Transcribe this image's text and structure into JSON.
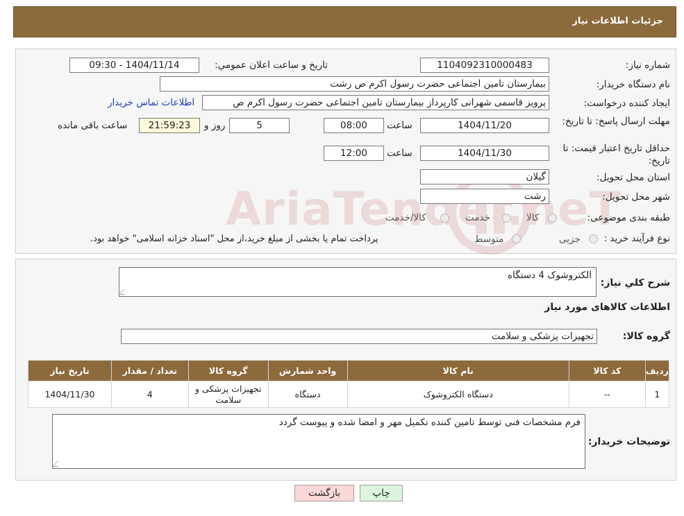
{
  "header": {
    "title": "جزئیات اطلاعات نیاز"
  },
  "form": {
    "need_number": {
      "label": "شماره نیاز:",
      "value": "1104092310000483"
    },
    "announce_datetime": {
      "label": "تاریخ و ساعت اعلان عمومي:",
      "value": "1404/11/14 - 09:30"
    },
    "buyer_org": {
      "label": "نام دستگاه خریدار:",
      "value": "بیمارستان  تامین اجتماعی حضرت رسول اکرم ص رشت"
    },
    "requester": {
      "label": "ایجاد کننده درخواست:",
      "value": "پرویز قاسمی شهرانی کارپرداز بیمارستان  تامین اجتماعی حضرت رسول اکرم ص"
    },
    "contact_link": "اطلاعات تماس خریدار",
    "send_deadline": {
      "label": "مهلت ارسال پاسخ: تا تاریخ:",
      "date": "1404/11/20",
      "time_label": "ساعت",
      "time": "08:00",
      "days": "5",
      "days_label": "روز و",
      "remaining": "21:59:23",
      "remaining_label": "ساعت باقی مانده"
    },
    "price_validity": {
      "label": "حداقل تاریخ اعتبار قیمت: تا تاریخ:",
      "date": "1404/11/30",
      "time_label": "ساعت",
      "time": "12:00"
    },
    "province": {
      "label": "استان محل تحویل:",
      "value": "گیلان"
    },
    "city": {
      "label": "شهر محل تحویل:",
      "value": "رشت"
    },
    "category": {
      "label": "طبقه بندی موضوعی:",
      "options": [
        "کالا",
        "خدمت",
        "کالا/خدمت"
      ]
    },
    "process": {
      "label": "نوع فرآیند خرید :",
      "options": [
        "جزیی",
        "متوسط"
      ],
      "note": "پرداخت تمام یا بخشی از مبلغ خرید،از محل \"اسناد خزانه اسلامی\" خواهد بود."
    }
  },
  "watermark": "AriaTender.neT",
  "details": {
    "summary_label": "شرح کلي نياز:",
    "summary_value": "الکتروشوک 4 دستگاه",
    "goods_title": "اطلاعات کالاهای مورد نیاز",
    "goods_group_label": "گروه کالا:",
    "goods_group_value": "تجهیزات پزشکی و سلامت"
  },
  "table": {
    "headers": [
      "ردیف",
      "کد کالا",
      "نام کالا",
      "واحد شمارش",
      "گروه کالا",
      "تعداد / مقدار",
      "تاریخ نیاز"
    ],
    "rows": [
      [
        "1",
        "--",
        "دستگاه الکتروشوک",
        "دستگاه",
        "تجهیزات پزشکی و سلامت",
        "4",
        "1404/11/30"
      ]
    ]
  },
  "buyer_notes": {
    "label": "توضیحات خریدار:",
    "value": "فرم مشخصات فنی توسط تامین کننده تکمیل مهر و امضا شده و پیوست گردد"
  },
  "buttons": {
    "back": "بازگشت",
    "print": "چاپ"
  }
}
